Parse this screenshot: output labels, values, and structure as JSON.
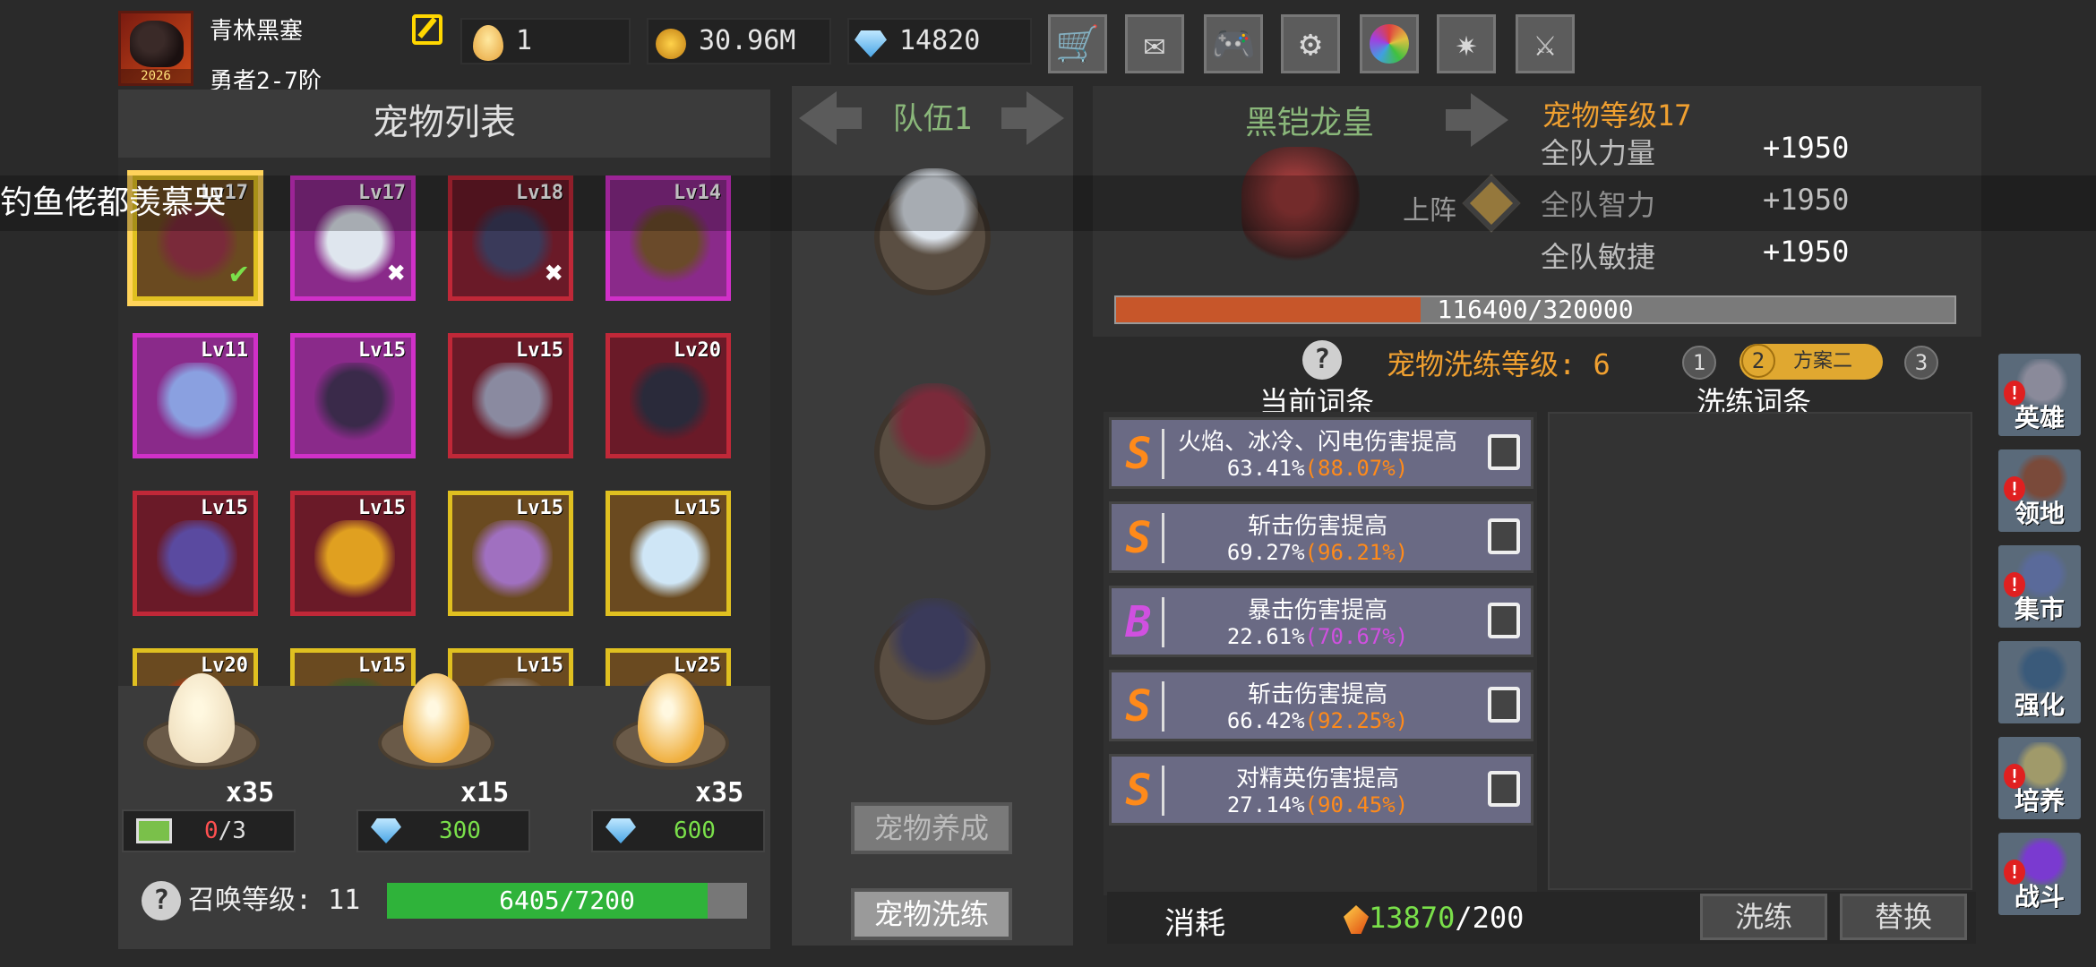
{
  "player": {
    "name": "青林黑塞",
    "rank": "勇者2-7阶",
    "avatar_year": "2026"
  },
  "resources": {
    "eggs": "1",
    "gold": "30.96M",
    "gems": "14820"
  },
  "top_buttons": [
    "cart-icon",
    "mail-icon",
    "gamepad-icon",
    "gear-icon",
    "color-wheel-icon",
    "firework-icon",
    "crossed-swords-icon"
  ],
  "pet_list": {
    "title": "宠物列表",
    "pets": [
      {
        "lv": "Lv17",
        "rarity": "gold",
        "selected": true,
        "check": "green",
        "color": "#7a2a3a"
      },
      {
        "lv": "Lv17",
        "rarity": "purple",
        "check": "white",
        "color": "#dfe6ee"
      },
      {
        "lv": "Lv18",
        "rarity": "red",
        "check": "white",
        "color": "#3a3a5a"
      },
      {
        "lv": "Lv14",
        "rarity": "purple",
        "color": "#6a4a2a"
      },
      {
        "lv": "Lv11",
        "rarity": "purple",
        "color": "#8aa0e0"
      },
      {
        "lv": "Lv15",
        "rarity": "purple",
        "color": "#3a2a4a"
      },
      {
        "lv": "Lv15",
        "rarity": "red",
        "color": "#8a8aa0"
      },
      {
        "lv": "Lv20",
        "rarity": "red",
        "color": "#2a2a3a"
      },
      {
        "lv": "Lv15",
        "rarity": "red",
        "color": "#5a4aa0"
      },
      {
        "lv": "Lv15",
        "rarity": "red",
        "color": "#e0a020"
      },
      {
        "lv": "Lv15",
        "rarity": "gold",
        "color": "#a070c0"
      },
      {
        "lv": "Lv15",
        "rarity": "gold",
        "color": "#cfe6f6"
      },
      {
        "lv": "Lv20",
        "rarity": "gold",
        "color": "#c03010"
      },
      {
        "lv": "Lv15",
        "rarity": "gold",
        "color": "#3a5a2a"
      },
      {
        "lv": "Lv15",
        "rarity": "gold",
        "color": "#8a7a6a"
      },
      {
        "lv": "Lv25",
        "rarity": "gold",
        "color": "#2a3a6a"
      }
    ]
  },
  "marquee": "钓鱼佬都羡慕哭",
  "eggs": [
    {
      "count": "x35",
      "price_type": "ad",
      "price": "0",
      "price_max": "/3",
      "color": "#f0e0c0"
    },
    {
      "count": "x15",
      "price_type": "gem",
      "price": "300",
      "color": "#f0b040"
    },
    {
      "count": "x35",
      "price_type": "gem",
      "price": "600",
      "color": "#f0b040"
    }
  ],
  "summon": {
    "label": "召唤等级: ",
    "level": "11",
    "progress": "6405/7200",
    "current": 6405,
    "max": 7200
  },
  "team": {
    "title": "队伍1",
    "slots": [
      "#dfe6ee",
      "#7a2a3a",
      "#3a3a5a"
    ],
    "btn_cultivate": "宠物养成",
    "btn_refine": "宠物洗练"
  },
  "detail": {
    "name": "黑铠龙皇",
    "level_label": "宠物等级17",
    "deploy_label": "上阵",
    "stats": [
      {
        "label": "全队力量",
        "value": "+1950"
      },
      {
        "label": "全队智力",
        "value": "+1950"
      },
      {
        "label": "全队敏捷",
        "value": "+1950"
      }
    ],
    "exp_text": "116400/320000",
    "exp_current": 116400,
    "exp_max": 320000
  },
  "refine": {
    "title": "宠物洗练等级: 6",
    "schemes": [
      "1",
      "2",
      "3"
    ],
    "active_scheme_label": "方案二",
    "current_header": "当前词条",
    "refine_header": "洗练词条",
    "affixes": [
      {
        "grade": "S",
        "name": "火焰、冰冷、闪电伤害提高",
        "value": "63.41%",
        "max": "(88.07%)"
      },
      {
        "grade": "S",
        "name": "斩击伤害提高",
        "value": "69.27%",
        "max": "(96.21%)"
      },
      {
        "grade": "B",
        "name": "暴击伤害提高",
        "value": "22.61%",
        "max": "(70.67%)"
      },
      {
        "grade": "S",
        "name": "斩击伤害提高",
        "value": "66.42%",
        "max": "(92.25%)"
      },
      {
        "grade": "S",
        "name": "对精英伤害提高",
        "value": "27.14%",
        "max": "(90.45%)"
      }
    ],
    "cost_label": "消耗",
    "cost_have": "13870",
    "cost_need": "/200",
    "btn_refine": "洗练",
    "btn_replace": "替换"
  },
  "right_nav": [
    {
      "label": "英雄",
      "color": "#8a8a9a",
      "alert": true
    },
    {
      "label": "领地",
      "color": "#7a4a3a",
      "alert": true
    },
    {
      "label": "集市",
      "color": "#5a6a9a",
      "alert": true
    },
    {
      "label": "强化",
      "color": "#3a5a7a",
      "alert": false
    },
    {
      "label": "培养",
      "color": "#a09a6a",
      "alert": true
    },
    {
      "label": "战斗",
      "color": "#7a3ad0",
      "alert": true
    }
  ]
}
